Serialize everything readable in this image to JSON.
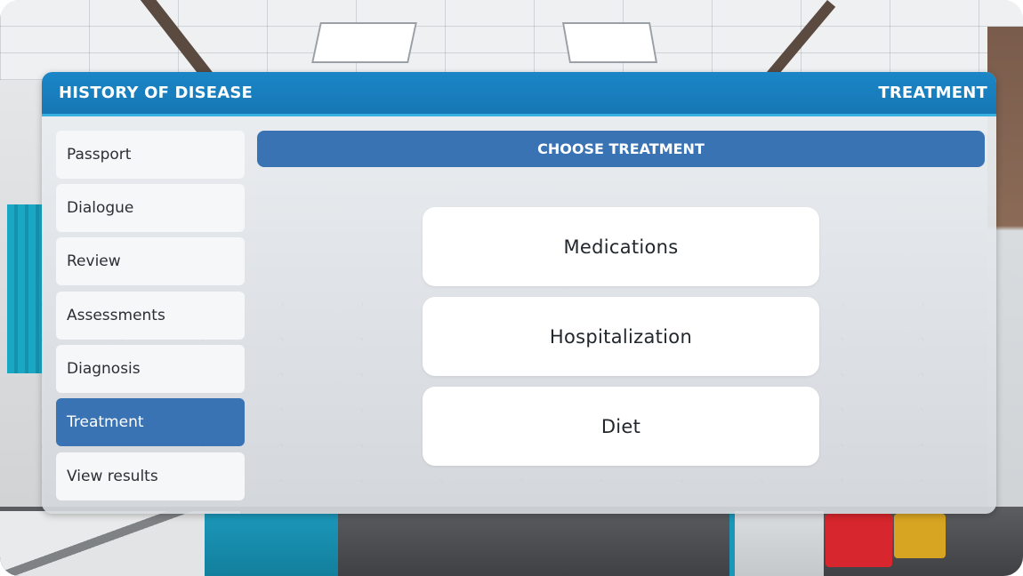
{
  "panel": {
    "title": "HISTORY OF DISEASE",
    "section": "TREATMENT"
  },
  "sidebar": {
    "items": [
      {
        "label": "Passport",
        "active": false
      },
      {
        "label": "Dialogue",
        "active": false
      },
      {
        "label": "Review",
        "active": false
      },
      {
        "label": "Assessments",
        "active": false
      },
      {
        "label": "Diagnosis",
        "active": false
      },
      {
        "label": "Treatment",
        "active": true
      },
      {
        "label": "View results",
        "active": false
      }
    ]
  },
  "content": {
    "heading": "CHOOSE TREATMENT",
    "options": [
      {
        "label": "Medications"
      },
      {
        "label": "Hospitalization"
      },
      {
        "label": "Diet"
      }
    ]
  },
  "colors": {
    "header_blue": "#1677b4",
    "accent_blue": "#3a73b3",
    "header_underline": "#38b1e2"
  }
}
